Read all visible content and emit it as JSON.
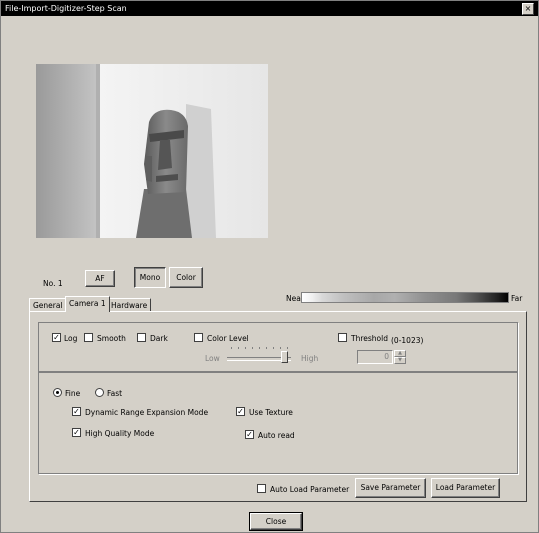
{
  "window": {
    "title": "File-Import-Digitizer-Step Scan",
    "close_glyph": "×"
  },
  "toolbar": {
    "no_label": "No. 1",
    "af_label": "AF",
    "mono_label": "Mono",
    "color_label": "Color"
  },
  "range_bar": {
    "near_label": "Near",
    "far_label": "Far"
  },
  "tabs": [
    {
      "label": "General",
      "active": false
    },
    {
      "label": "Camera 1",
      "active": true
    },
    {
      "label": "Hardware",
      "active": false
    }
  ],
  "options": {
    "log": {
      "label": "Log",
      "checked": true
    },
    "smooth": {
      "label": "Smooth",
      "checked": false
    },
    "dark": {
      "label": "Dark",
      "checked": false
    },
    "color_level": {
      "label": "Color Level",
      "checked": false
    },
    "threshold": {
      "label": "Threshold",
      "range": "(0-1023)",
      "checked": false,
      "value": "0"
    },
    "slider": {
      "low_label": "Low",
      "high_label": "High"
    }
  },
  "quality": {
    "fine": {
      "label": "Fine",
      "selected": true
    },
    "fast": {
      "label": "Fast",
      "selected": false
    },
    "dynamic_range": {
      "label": "Dynamic Range Expansion Mode",
      "checked": true
    },
    "use_texture": {
      "label": "Use Texture",
      "checked": true
    },
    "high_quality": {
      "label": "High Quality Mode",
      "checked": true
    },
    "auto_read": {
      "label": "Auto read",
      "checked": true
    }
  },
  "footer": {
    "auto_load": {
      "label": "Auto Load Parameter",
      "checked": false
    },
    "save_label": "Save Parameter",
    "load_label": "Load Parameter",
    "close_label": "Close"
  },
  "check_glyph": "✓",
  "colors": {
    "face": "#d4d0c8",
    "titlebar": "#000000"
  },
  "icons": [
    "close-icon",
    "spin-up-icon",
    "spin-down-icon"
  ]
}
